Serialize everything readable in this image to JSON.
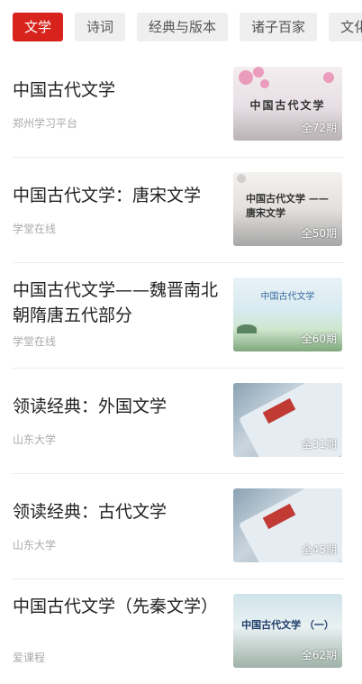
{
  "tabs": [
    {
      "label": "文学",
      "active": true
    },
    {
      "label": "诗词",
      "active": false
    },
    {
      "label": "经典与版本",
      "active": false
    },
    {
      "label": "诸子百家",
      "active": false
    },
    {
      "label": "文化",
      "active": false
    }
  ],
  "courses": [
    {
      "title": "中国古代文学",
      "source": "郑州学习平台",
      "thumb_text": "中国古代文学",
      "episodes": "全72期"
    },
    {
      "title": "中国古代文学：唐宋文学",
      "source": "学堂在线",
      "thumb_text": "中国古代文学 ——唐宋文学",
      "episodes": "全50期"
    },
    {
      "title": "中国古代文学——魏晋南北朝隋唐五代部分",
      "source": "学堂在线",
      "thumb_text": "中国古代文学",
      "episodes": "全60期"
    },
    {
      "title": "领读经典：外国文学",
      "source": "山东大学",
      "thumb_text": "",
      "episodes": "全31期"
    },
    {
      "title": "领读经典：古代文学",
      "source": "山东大学",
      "thumb_text": "",
      "episodes": "全45期"
    },
    {
      "title": "中国古代文学（先秦文学）",
      "source": "爱课程",
      "thumb_text": "中国古代文学 （一）",
      "episodes": "全62期"
    }
  ],
  "colors": {
    "accent": "#d8231d",
    "tab_bg": "#efefef",
    "secondary_text": "#aaaaaa"
  }
}
